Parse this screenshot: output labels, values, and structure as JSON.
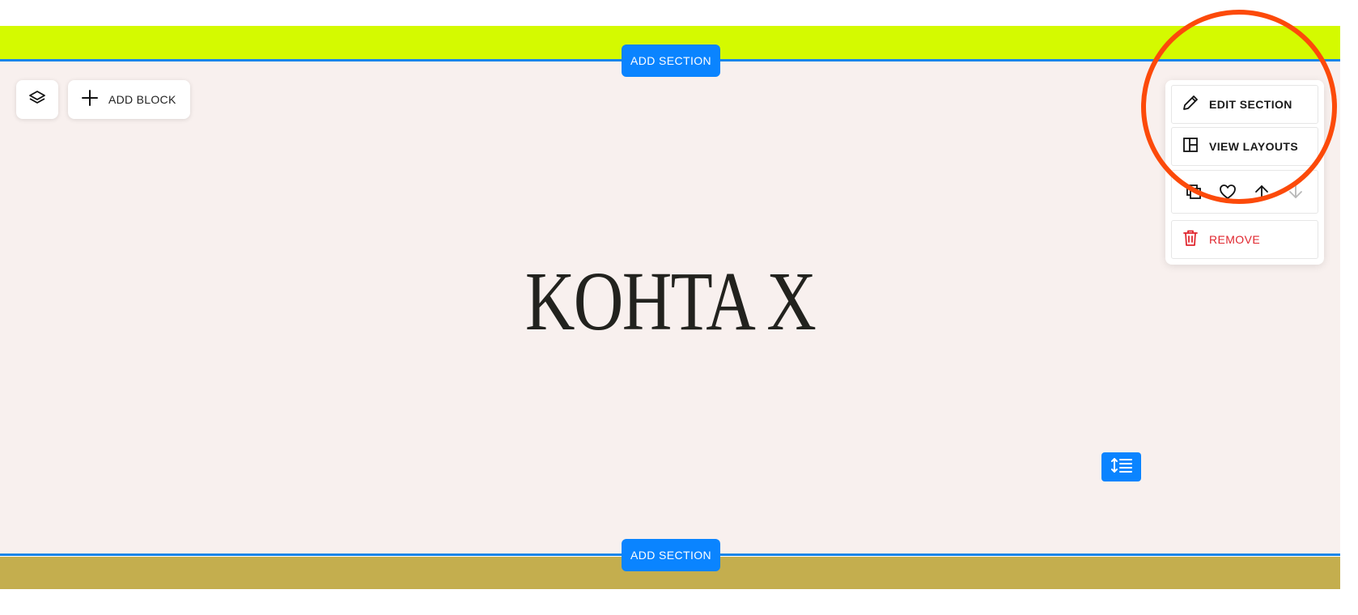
{
  "editor": {
    "add_section_label": "ADD SECTION",
    "add_block_label": "ADD BLOCK"
  },
  "section": {
    "heading": "KOHTA X"
  },
  "section_menu": {
    "edit_section_label": "EDIT SECTION",
    "view_layouts_label": "VIEW LAYOUTS",
    "remove_label": "REMOVE",
    "actions": [
      "duplicate-icon",
      "heart-icon",
      "arrow-up-icon",
      "arrow-down-icon"
    ]
  },
  "colors": {
    "top_band": "#d4fa00",
    "section_bg": "#f8f0ee",
    "bottom_band": "#c4ae4e",
    "accent_blue": "#0a84ff",
    "remove_red": "#e0262e",
    "highlight_orange": "#fc4a0a"
  }
}
